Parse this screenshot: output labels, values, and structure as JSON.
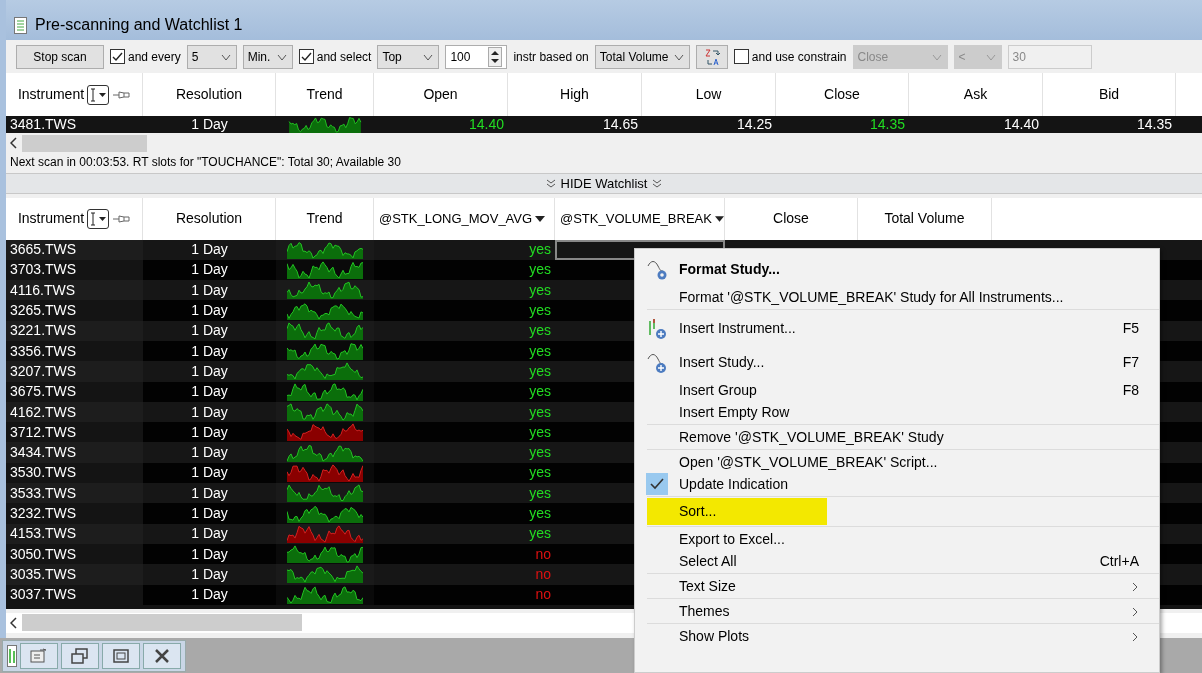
{
  "window": {
    "title": "Pre-scanning and Watchlist 1"
  },
  "toolbar": [
    {
      "kind": "button",
      "label": "Stop scan"
    },
    {
      "kind": "checkbox",
      "label": "and every",
      "checked": true
    },
    {
      "kind": "select",
      "value": "5",
      "disabled": false
    },
    {
      "kind": "select",
      "value": "Min.",
      "disabled": false
    },
    {
      "kind": "checkbox",
      "label": "and select",
      "checked": true
    },
    {
      "kind": "select",
      "value": "Top",
      "disabled": false
    },
    {
      "kind": "spinner",
      "value": "100"
    },
    {
      "kind": "label",
      "text": "instr based on"
    },
    {
      "kind": "select",
      "value": "Total Volume",
      "disabled": false
    },
    {
      "kind": "sortbutton"
    },
    {
      "kind": "checkbox",
      "label": "and use constrain",
      "checked": false
    },
    {
      "kind": "select",
      "value": "Close",
      "disabled": true
    },
    {
      "kind": "select",
      "value": "<",
      "disabled": true
    },
    {
      "kind": "input",
      "value": "30",
      "disabled": true
    }
  ],
  "scanner": {
    "columns": [
      "Instrument",
      "Resolution",
      "Trend",
      "Open",
      "High",
      "Low",
      "Close",
      "Ask",
      "Bid"
    ],
    "rows": [
      {
        "instrument": "3481.TWS",
        "resolution": "1 Day",
        "color": "#22c322",
        "values": [
          {
            "text": "14.40",
            "positive": true
          },
          {
            "text": "14.65",
            "positive": false
          },
          {
            "text": "14.25",
            "positive": false
          },
          {
            "text": "14.35",
            "positive": true
          },
          {
            "text": "14.40",
            "positive": false
          },
          {
            "text": "14.35",
            "positive": false
          }
        ]
      }
    ]
  },
  "status": "Next scan in 00:03:53. RT slots for \"TOUCHANCE\": Total 30; Available 30",
  "hide_bar": "HIDE Watchlist",
  "watchlist": {
    "columns": [
      {
        "label": "Instrument",
        "kind": "instrument"
      },
      {
        "label": "Resolution",
        "kind": "plain"
      },
      {
        "label": "Trend",
        "kind": "plain"
      },
      {
        "label": "@STK_LONG_MOV_AVG",
        "kind": "study"
      },
      {
        "label": "@STK_VOLUME_BREAK",
        "kind": "study"
      },
      {
        "label": "Close",
        "kind": "plain"
      },
      {
        "label": "Total Volume",
        "kind": "plain"
      }
    ],
    "rows": [
      {
        "instrument": "3665.TWS",
        "resolution": "1 Day",
        "color": "#22c322",
        "selected": true,
        "values": [
          {
            "text": "yes",
            "positive": true
          }
        ]
      },
      {
        "instrument": "3703.TWS",
        "resolution": "1 Day",
        "color": "#22c322",
        "selected": false,
        "values": [
          {
            "text": "yes",
            "positive": true
          }
        ]
      },
      {
        "instrument": "4116.TWS",
        "resolution": "1 Day",
        "color": "#22c322",
        "selected": false,
        "values": [
          {
            "text": "yes",
            "positive": true
          }
        ]
      },
      {
        "instrument": "3265.TWS",
        "resolution": "1 Day",
        "color": "#22c322",
        "selected": false,
        "values": [
          {
            "text": "yes",
            "positive": true
          }
        ]
      },
      {
        "instrument": "3221.TWS",
        "resolution": "1 Day",
        "color": "#22c322",
        "selected": false,
        "values": [
          {
            "text": "yes",
            "positive": true
          }
        ]
      },
      {
        "instrument": "3356.TWS",
        "resolution": "1 Day",
        "color": "#22c322",
        "selected": false,
        "values": [
          {
            "text": "yes",
            "positive": true
          }
        ]
      },
      {
        "instrument": "3207.TWS",
        "resolution": "1 Day",
        "color": "#22c322",
        "selected": false,
        "values": [
          {
            "text": "yes",
            "positive": true
          }
        ]
      },
      {
        "instrument": "3675.TWS",
        "resolution": "1 Day",
        "color": "#22c322",
        "selected": false,
        "values": [
          {
            "text": "yes",
            "positive": true
          }
        ]
      },
      {
        "instrument": "4162.TWS",
        "resolution": "1 Day",
        "color": "#22c322",
        "selected": false,
        "values": [
          {
            "text": "yes",
            "positive": true
          }
        ]
      },
      {
        "instrument": "3712.TWS",
        "resolution": "1 Day",
        "color": "#d42020",
        "selected": false,
        "values": [
          {
            "text": "yes",
            "positive": true
          }
        ]
      },
      {
        "instrument": "3434.TWS",
        "resolution": "1 Day",
        "color": "#22c322",
        "selected": false,
        "values": [
          {
            "text": "yes",
            "positive": true
          }
        ]
      },
      {
        "instrument": "3530.TWS",
        "resolution": "1 Day",
        "color": "#d42020",
        "selected": false,
        "values": [
          {
            "text": "yes",
            "positive": true
          }
        ]
      },
      {
        "instrument": "3533.TWS",
        "resolution": "1 Day",
        "color": "#22c322",
        "selected": false,
        "values": [
          {
            "text": "yes",
            "positive": true
          }
        ]
      },
      {
        "instrument": "3232.TWS",
        "resolution": "1 Day",
        "color": "#22c322",
        "selected": false,
        "values": [
          {
            "text": "yes",
            "positive": true
          }
        ]
      },
      {
        "instrument": "4153.TWS",
        "resolution": "1 Day",
        "color": "#d42020",
        "selected": false,
        "values": [
          {
            "text": "yes",
            "positive": true
          }
        ]
      },
      {
        "instrument": "3050.TWS",
        "resolution": "1 Day",
        "color": "#22c322",
        "selected": false,
        "values": [
          {
            "text": "no",
            "positive": false
          }
        ]
      },
      {
        "instrument": "3035.TWS",
        "resolution": "1 Day",
        "color": "#22c322",
        "selected": false,
        "values": [
          {
            "text": "no",
            "positive": false
          }
        ]
      },
      {
        "instrument": "3037.TWS",
        "resolution": "1 Day",
        "color": "#22c322",
        "selected": false,
        "values": [
          {
            "text": "no",
            "positive": false
          }
        ]
      }
    ]
  },
  "context_menu": {
    "groups": [
      [
        {
          "label": "Format Study...",
          "default": true,
          "checked": false,
          "submenu": false,
          "highlighted": false
        },
        {
          "label": "Format '@STK_VOLUME_BREAK' Study for All Instruments...",
          "default": false,
          "checked": false,
          "submenu": false,
          "highlighted": false
        }
      ],
      [
        {
          "label": "Insert Instrument...",
          "shortcut": "F5",
          "default": false,
          "checked": false,
          "submenu": false,
          "highlighted": false
        },
        {
          "label": "Insert Study...",
          "shortcut": "F7",
          "default": false,
          "checked": false,
          "submenu": false,
          "highlighted": false
        },
        {
          "label": "Insert Group",
          "shortcut": "F8",
          "default": false,
          "checked": false,
          "submenu": false,
          "highlighted": false
        },
        {
          "label": "Insert Empty Row",
          "default": false,
          "checked": false,
          "submenu": false,
          "highlighted": false
        }
      ],
      [
        {
          "label": "Remove '@STK_VOLUME_BREAK' Study",
          "default": false,
          "checked": false,
          "submenu": false,
          "highlighted": false
        }
      ],
      [
        {
          "label": "Open '@STK_VOLUME_BREAK' Script...",
          "default": false,
          "checked": false,
          "submenu": false,
          "highlighted": false
        },
        {
          "label": "Update Indication",
          "default": false,
          "checked": true,
          "submenu": false,
          "highlighted": false
        }
      ],
      [
        {
          "label": "Sort...",
          "default": false,
          "checked": false,
          "submenu": false,
          "highlighted": true
        }
      ],
      [
        {
          "label": "Export to Excel...",
          "default": false,
          "checked": false,
          "submenu": false,
          "highlighted": false
        },
        {
          "label": "Select All",
          "shortcut": "Ctrl+A",
          "default": false,
          "checked": false,
          "submenu": false,
          "highlighted": false
        }
      ],
      [
        {
          "label": "Text Size",
          "default": false,
          "checked": false,
          "submenu": true,
          "highlighted": false
        }
      ],
      [
        {
          "label": "Themes",
          "default": false,
          "checked": false,
          "submenu": true,
          "highlighted": false
        }
      ],
      [
        {
          "label": "Show Plots",
          "default": false,
          "checked": false,
          "submenu": true,
          "highlighted": false
        }
      ]
    ]
  }
}
